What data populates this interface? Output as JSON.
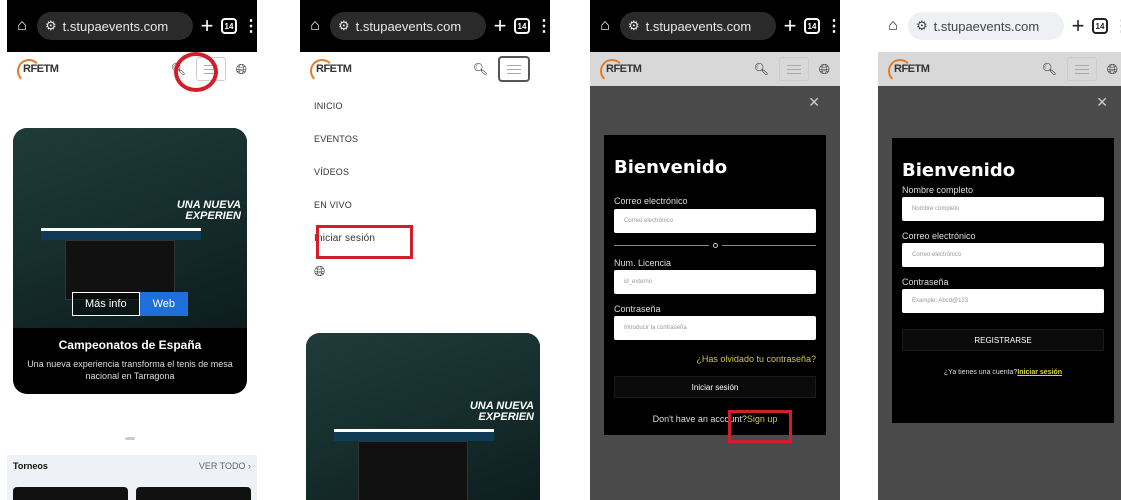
{
  "browser": {
    "url": "t.stupaevents.com",
    "tab_count": "14"
  },
  "site": {
    "logo": "RFETM"
  },
  "home": {
    "card_headline_1": "UNA NUEVA",
    "card_headline_2": "EXPERIEN",
    "btn_more": "Más info",
    "btn_web": "Web",
    "card_title": "Campeonatos de España",
    "card_desc": "Una nueva experiencia transforma el tenis de mesa nacional en Tarragona",
    "section_title": "Torneos",
    "section_link": "VER TODO ›"
  },
  "menu": {
    "items": [
      "INICIO",
      "EVENTOS",
      "VÍDEOS",
      "EN VIVO",
      "Iniciar sesión"
    ]
  },
  "login": {
    "title": "Bienvenido",
    "email_label": "Correo electrónico",
    "email_placeholder": "Correo electrónico",
    "license_label": "Num. Licencia",
    "license_placeholder": "id_externo",
    "password_label": "Contraseña",
    "password_placeholder": "Introducir la contraseña",
    "forgot": "¿Has olvidado tu contraseña?",
    "submit": "Iniciar sesión",
    "no_account": "Don't have an account?",
    "sign_up": "Sign up"
  },
  "register": {
    "title": "Bienvenido",
    "name_label": "Nombre completo",
    "name_placeholder": "Nombre completo",
    "email_label": "Correo electrónico",
    "email_placeholder": "Correo electrónico",
    "password_label": "Contraseña",
    "password_placeholder": "Example: Abcd@123",
    "submit": "REGISTRARSE",
    "have_account": "¿Ya tienes una cuenta?",
    "login_link": "Iniciar sesión"
  },
  "colors": {
    "highlight": "#d11e2a",
    "accent_link": "#c9c94a",
    "web_button": "#1e6fd9"
  }
}
